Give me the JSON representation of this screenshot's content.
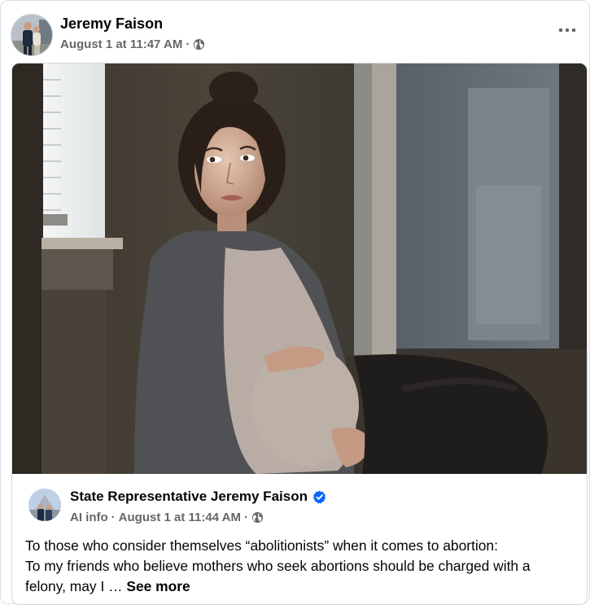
{
  "post": {
    "author": "Jeremy Faison",
    "timestamp": "August 1 at 11:47 AM",
    "separator": "·",
    "audience_icon": "globe-icon",
    "more_icon": "more-options-icon"
  },
  "shared_post": {
    "author": "State Representative Jeremy Faison",
    "verified_icon": "verified-badge-icon",
    "ai_info": "AI info",
    "separator": "·",
    "timestamp": "August 1 at 11:44 AM",
    "audience_icon": "globe-icon",
    "line1": "To those who consider themselves “abolitionists” when it comes to abortion:",
    "line2_a": "To my friends who believe mothers who seek abortions should be charged with a",
    "line2_b": "felony, may I … ",
    "see_more": "See more"
  },
  "colors": {
    "text": "#050505",
    "secondary": "#65676b",
    "verified": "#0866ff",
    "border": "#dcdfe3"
  }
}
